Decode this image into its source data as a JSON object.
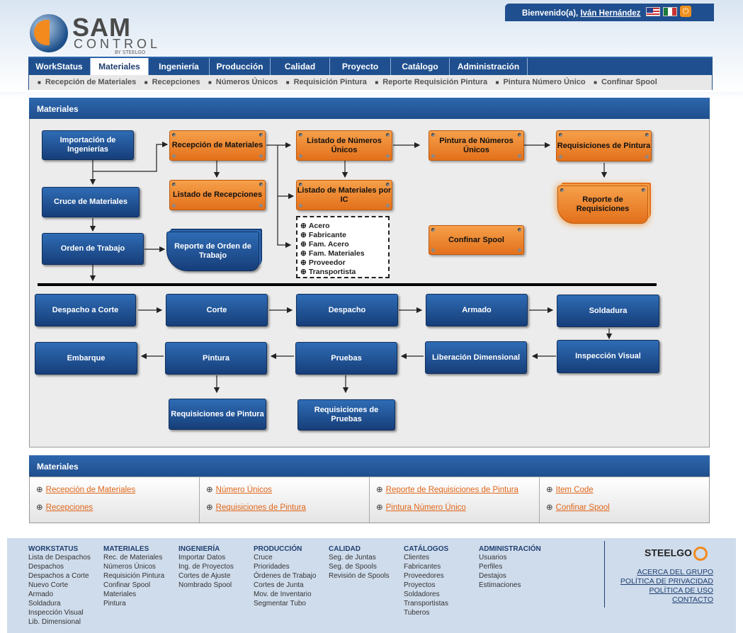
{
  "header": {
    "logo_main": "SAM",
    "logo_sub": "CONTROL",
    "logo_by": "BY STEELGO",
    "welcome": "Bienvenido(a),",
    "user": "Iván Hernández",
    "power_glyph": "⏻"
  },
  "nav": {
    "tabs": [
      "WorkStatus",
      "Materiales",
      "Ingeniería",
      "Producción",
      "Calidad",
      "Proyecto",
      "Catálogo",
      "Administración"
    ],
    "active": "Materiales"
  },
  "subnav": [
    "Recepción de Materiales",
    "Recepciones",
    "Números Únicos",
    "Requisición Pintura",
    "Reporte Requisición Pintura",
    "Pintura Número Único",
    "Confinar Spool"
  ],
  "diagram": {
    "title": "Materiales",
    "nodes": {
      "importacion": "Importación de Ingenierías",
      "cruce": "Cruce de Materiales",
      "orden": "Orden de Trabajo",
      "reporte_orden": "Reporte de Orden de Trabajo",
      "recepcion": "Recepción de Materiales",
      "listado_recepciones": "Listado de Recepciones",
      "listado_nu": "Listado de Números Únicos",
      "listado_ic": "Listado de Materiales por IC",
      "pintura_nu": "Pintura de Números Únicos",
      "req_pintura_top": "Requisiciones de Pintura",
      "reporte_req": "Reporte de Requisiciones",
      "confinar": "Confinar Spool",
      "despacho_corte": "Despacho a Corte",
      "corte": "Corte",
      "despacho": "Despacho",
      "armado": "Armado",
      "soldadura": "Soldadura",
      "embarque": "Embarque",
      "pintura": "Pintura",
      "pruebas": "Pruebas",
      "liberacion": "Liberación Dimensional",
      "inspeccion": "Inspección Visual",
      "req_pintura": "Requisiciones de Pintura",
      "req_pruebas": "Requisiciones de Pruebas"
    },
    "legend": [
      "Acero",
      "Fabricante",
      "Fam. Acero",
      "Fam. Materiales",
      "Proveedor",
      "Transportista"
    ]
  },
  "links_panel": {
    "title": "Materiales",
    "columns": [
      [
        "Recepción de Materiales",
        "Recepciones"
      ],
      [
        "Número Únicos",
        "Requisiciones de Pintura"
      ],
      [
        "Reporte de Requisiciones de Pintura",
        "Pintura Número Único"
      ],
      [
        "Item Code",
        "Confinar Spool"
      ]
    ]
  },
  "footer": {
    "columns": [
      {
        "title": "WORKSTATUS",
        "items": [
          "Lista de Despachos",
          "Despachos",
          "Despachos a Corte",
          "Nuevo Corte",
          "Armado",
          "Soldadura",
          "Inspección Visual",
          "Lib. Dimensional"
        ]
      },
      {
        "title": "MATERIALES",
        "items": [
          "Rec. de Materiales",
          "Números Únicos",
          "Requisición Pintura",
          "Confinar Spool",
          "Materiales",
          "Pintura"
        ]
      },
      {
        "title": "INGENIERÍA",
        "items": [
          "Importar Datos",
          "Ing. de Proyectos",
          "Cortes de Ajuste",
          "Nombrado Spool"
        ]
      },
      {
        "title": "PRODUCCIÓN",
        "items": [
          "Cruce",
          "Prioridades",
          "Órdenes de Trabajo",
          "Cortes de Junta",
          "Mov. de Inventario",
          "Segmentar Tubo"
        ]
      },
      {
        "title": "CALIDAD",
        "items": [
          "Seg. de Juntas",
          "Seg. de Spools",
          "Revisión de Spools"
        ]
      },
      {
        "title": "CATÁLOGOS",
        "items": [
          "Clientes",
          "Fabricantes",
          "Proveedores",
          "Proyectos",
          "Soldadores",
          "Transportistas",
          "Tuberos"
        ]
      },
      {
        "title": "ADMINISTRACIÓN",
        "items": [
          "Usuarios",
          "Perfiles",
          "Destajos",
          "Estimaciones"
        ]
      }
    ],
    "brand": "STEELGO",
    "links": [
      "ACERCA DEL GRUPO",
      "POLÍTICA DE PRIVACIDAD",
      "POLÍTICA DE USO",
      "CONTACTO"
    ]
  }
}
